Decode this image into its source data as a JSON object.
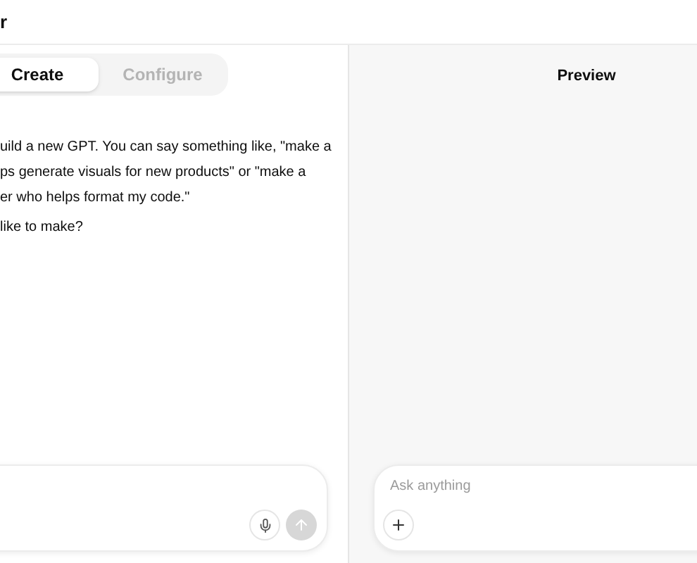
{
  "header": {
    "title": "r"
  },
  "builder": {
    "tabs": [
      {
        "label": "Create",
        "selected": true
      },
      {
        "label": "Configure",
        "selected": false
      }
    ],
    "message_lines": [
      "uild a new GPT. You can say something like, \"make a",
      "ps generate visuals for new products\" or \"make a",
      "er who helps format my code.\""
    ],
    "question": "like to make?"
  },
  "preview": {
    "title": "Preview",
    "composer": {
      "placeholder": "Ask anything"
    }
  }
}
